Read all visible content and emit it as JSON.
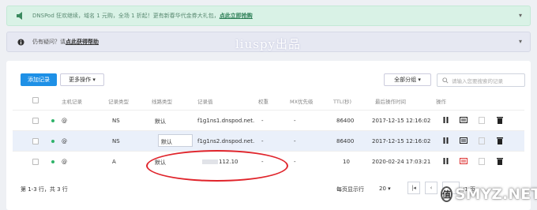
{
  "banner_top": {
    "text": "DNSPod 狂欢继续，域名 1 元购，全场 1 折起！更有新春华代金券大礼包，",
    "link": "点此立即抢购",
    "close": "▾"
  },
  "banner_mid": {
    "text": "仍有疑问？请",
    "link": "点此获得帮助",
    "close": "▾"
  },
  "watermark": "liuspy出品",
  "toolbar": {
    "add_label": "添加记录",
    "more_label": "更多操作 ▾",
    "group_label": "全部分组 ▾",
    "search_placeholder": "请输入您要搜索的记录"
  },
  "columns": [
    "主机记录",
    "记录类型",
    "线路类型",
    "记录值",
    "权重",
    "MX优先级",
    "TTL(秒)",
    "最后操作时间",
    "操作"
  ],
  "rows": [
    {
      "host": "@",
      "type": "NS",
      "line": "默认",
      "value": "f1g1ns1.dnspod.net.",
      "weight": "-",
      "mx": "-",
      "ttl": "86400",
      "time": "2017-12-15 12:16:02"
    },
    {
      "host": "@",
      "type": "NS",
      "line": "默认",
      "value": "f1g1ns2.dnspod.net.",
      "weight": "-",
      "mx": "-",
      "ttl": "86400",
      "time": "2017-12-15 12:16:02"
    },
    {
      "host": "@",
      "type": "A",
      "line": "默认",
      "value": "112.10",
      "weight": "-",
      "mx": "-",
      "ttl": "10",
      "time": "2020-02-24 17:03:21"
    }
  ],
  "footer": {
    "count": "第 1-3 行，共 3 行",
    "per_page_label": "每页显示行",
    "per_page_value": "20 ▾",
    "page_of": "/1 页"
  },
  "logo": {
    "badge": "值",
    "text": "SMYZ.NET"
  },
  "colors": {
    "primary": "#1e90e6",
    "status_dot": "#2fb36a",
    "highlight": "#e0242b"
  }
}
